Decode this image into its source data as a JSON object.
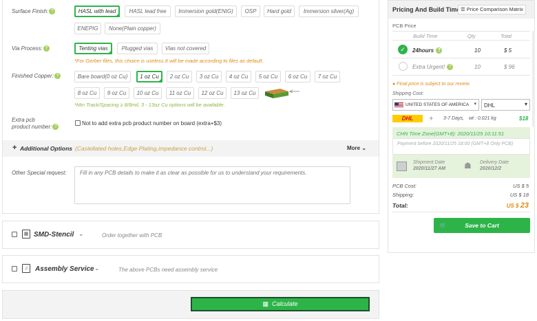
{
  "surface_finish": {
    "label": "Surface Finish:",
    "options": [
      "HASL with lead",
      "HASL lead free",
      "Immersion gold(ENIG)",
      "OSP",
      "Hard gold",
      "Immersion silver(Ag)",
      "ENEPIG",
      "None(Plain copper)"
    ]
  },
  "via_process": {
    "label": "Via Process:",
    "options": [
      "Tenting vias",
      "Plugged vias",
      "Vias not covered"
    ],
    "note": "*For Gerber files, this choice is useless.It will be made according to files as default."
  },
  "finished_copper": {
    "label": "Finished Copper:",
    "options": [
      "Bare board(0 oz Cu)",
      "1 oz Cu",
      "2 oz Cu",
      "3 oz Cu",
      "4 oz Cu",
      "5 oz Cu",
      "6 oz Cu",
      "7 oz Cu",
      "8 oz Cu",
      "9 oz Cu",
      "10 oz Cu",
      "11 oz Cu",
      "12 oz Cu",
      "13 oz Cu"
    ],
    "note": "*Min Track/Spacing ≥ 8/8mil, 3 - 13oz Cu options will be available."
  },
  "extra_number": {
    "label_line1": "Extra pcb",
    "label_line2": "product number:",
    "checkbox_label": "Not to add extra pcb product number on board (extra+$3)"
  },
  "additional": {
    "title": "Additional Options",
    "subtitle": "(Castellated holes,Edge Plating,impedance control...)",
    "more": "More"
  },
  "special_request": {
    "label": "Other Special request:",
    "placeholder": "Fill in any PCB details to make it as clear as possible for us to understand your requirements."
  },
  "smd_stencil": {
    "title": "SMD-Stencil",
    "desc": "Order together with PCB"
  },
  "assembly": {
    "title": "Assembly Service",
    "desc": "The above PCBs need assembly service"
  },
  "calculate": {
    "label": "Calculate"
  },
  "pricing": {
    "title": "Pricing And Build Time",
    "matrix_label": "Price Comparison Matrix",
    "pcb_price_label": "PCB Price",
    "columns": [
      "Build Time",
      "Qty",
      "Total"
    ],
    "rows": [
      {
        "time": "24hours",
        "qty": "10",
        "total": "$ 5"
      },
      {
        "time": "Extra Urgent!",
        "qty": "10",
        "total": "$ 96"
      }
    ],
    "final_note": "Final price is subject to our review.",
    "shipping_cost_label": "Shipping Cost:",
    "country": "UNITED STATES OF AMERICA",
    "carrier": "DHL",
    "dhl_logo": "DHL",
    "ship_days": "3-7 Days,",
    "ship_weight": "wt : 0.021 kg",
    "ship_price": "$18",
    "timezone": "CHN Time Zone(GMT+8): 2020/11/25 10:11:51",
    "payment_note": "Payment before 2020/11/25 18:00 (GMT+8 Only PCB)",
    "shipment_label": "Shipment Date",
    "shipment_date": "2020/11/27 AM",
    "delivery_label": "Delivery Date",
    "delivery_date": "2020/12/2",
    "pcb_cost_label": "PCB Cost:",
    "pcb_cost": "US $ 5",
    "shipping_label": "Shipping:",
    "shipping": "US $ 18",
    "total_label": "Total:",
    "total_prefix": "US $",
    "total_value": "23",
    "cart_label": "Save to Cart"
  },
  "colors": {
    "green": "#2db449",
    "orange": "#e08a14",
    "light_green_bg": "#e5f2dc"
  }
}
